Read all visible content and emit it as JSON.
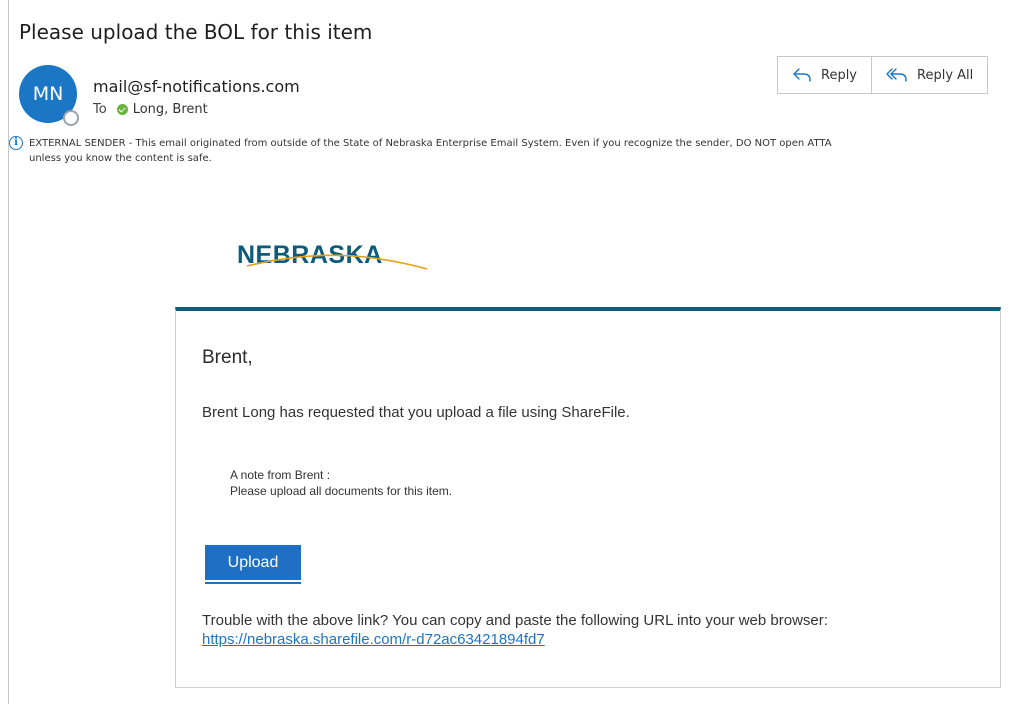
{
  "email": {
    "subject": "Please upload the BOL for this item",
    "avatar_initials": "MN",
    "sender": "mail@sf-notifications.com",
    "to_label": "To",
    "recipient": "Long, Brent",
    "actions": {
      "reply": "Reply",
      "reply_all": "Reply All"
    },
    "banner": {
      "line1": "EXTERNAL SENDER - This email originated from outside of the State of Nebraska Enterprise Email System. Even if you recognize the sender, DO NOT open ATTA",
      "line2": "unless you know the content is safe."
    }
  },
  "body": {
    "logo_text": "NEBRASKA",
    "greeting": "Brent,",
    "requested": "Brent Long has requested that you upload a file using ShareFile.",
    "note_label": "A note from Brent :",
    "note_text": "Please upload all documents for this item.",
    "upload_button": "Upload",
    "trouble_text": "Trouble with the above link? You can copy and paste the following URL into your web browser:",
    "url": "https://nebraska.sharefile.com/r-d72ac63421894fd7"
  },
  "colors": {
    "accent": "#1b76c6",
    "card_top": "#0f5f7c",
    "logo": "#0d5b7c",
    "logo_swoosh": "#e3a21a",
    "presence_ok": "#6bb23b"
  }
}
